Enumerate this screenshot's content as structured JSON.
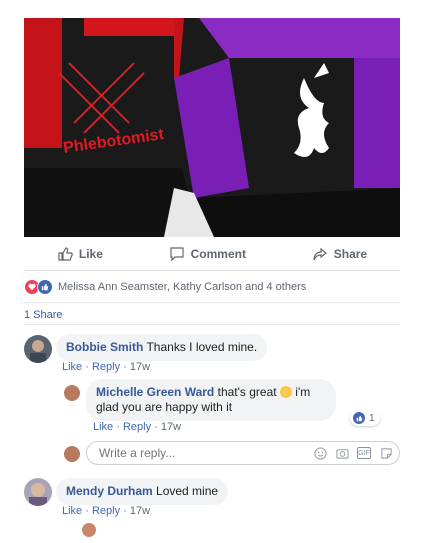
{
  "post": {
    "photo_text": "Phlebotomist",
    "actions": {
      "like": "Like",
      "comment": "Comment",
      "share": "Share"
    },
    "reactions_text": "Melissa Ann Seamster, Kathy Carlson and 4 others",
    "shares_text": "1 Share"
  },
  "comments": [
    {
      "name": "Bobbie Smith",
      "text": "Thanks I loved mine.",
      "like": "Like",
      "reply": "Reply",
      "time": "17w"
    },
    {
      "name": "Michelle Green Ward",
      "text": "that's great",
      "text2": "i'm glad you are happy with it",
      "like": "Like",
      "reply": "Reply",
      "time": "17w",
      "reaction_count": "1"
    },
    {
      "name": "Mendy Durham",
      "text": "Loved mine",
      "like": "Like",
      "reply": "Reply",
      "time": "17w"
    }
  ],
  "reply_box": {
    "placeholder": "Write a reply...",
    "icons": [
      "emoji-icon",
      "camera-icon",
      "gif-icon",
      "sticker-icon"
    ],
    "gif_label": "GIF"
  },
  "colors": {
    "link": "#385898",
    "like_blue": "#4267b2",
    "love_red": "#f33e58",
    "bubble": "#f2f3f5"
  }
}
